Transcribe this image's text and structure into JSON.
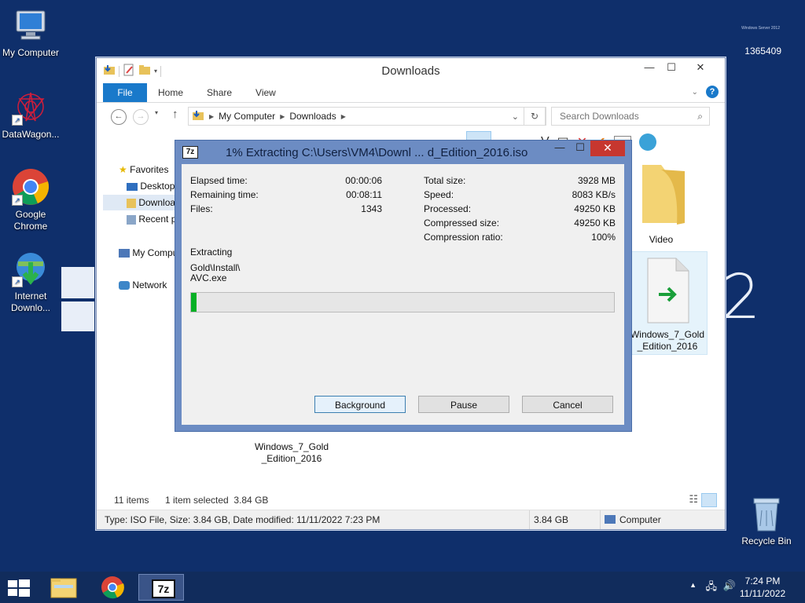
{
  "desktop": {
    "build_text": "1365409",
    "build_tiny": "Windows Server 2012",
    "bg_suffix": "2",
    "icons": [
      {
        "label": "My Computer",
        "icon": "computer-icon"
      },
      {
        "label": "DataWagon...",
        "icon": "datawagon-icon"
      },
      {
        "label": "Google Chrome",
        "icon": "chrome-icon"
      },
      {
        "label": "Internet Downlo...",
        "icon": "internet-download-manager-icon"
      },
      {
        "label": "Recycle Bin",
        "icon": "recycle-bin-icon"
      }
    ]
  },
  "explorer": {
    "title": "Downloads",
    "ribbon_tabs": [
      "File",
      "Home",
      "Share",
      "View"
    ],
    "address": {
      "seg1": "My Computer",
      "seg2": "Downloads"
    },
    "search_placeholder": "Search Downloads",
    "nav": {
      "favorites": "Favorites",
      "desktop": "Desktop",
      "downloads": "Downloads",
      "recent": "Recent places",
      "mycomputer": "My Computer",
      "network": "Network"
    },
    "files": {
      "video": "Video",
      "iso_right": "Windows_7_Gold\n_Edition_2016",
      "iso_bottom": "Windows_7_Gold\n_Edition_2016"
    },
    "status": {
      "items": "11 items",
      "selected": "1 item selected  3.84 GB"
    },
    "details": {
      "info": "Type: ISO File, Size: 3.84 GB, Date modified: 11/11/2022 7:23 PM",
      "size": "3.84 GB",
      "location": "Computer"
    }
  },
  "dialog": {
    "title": "1% Extracting C:\\Users\\VM4\\Downl ... d_Edition_2016.iso",
    "logo": "7z",
    "left": [
      {
        "label": "Elapsed time:",
        "value": "00:00:06"
      },
      {
        "label": "Remaining time:",
        "value": "00:08:11"
      },
      {
        "label": "Files:",
        "value": "1343"
      }
    ],
    "right": [
      {
        "label": "Total size:",
        "value": "3928 MB"
      },
      {
        "label": "Speed:",
        "value": "8083 KB/s"
      },
      {
        "label": "Processed:",
        "value": "49250 KB"
      },
      {
        "label": "Compressed size:",
        "value": "49250 KB"
      },
      {
        "label": "Compression ratio:",
        "value": "100%"
      }
    ],
    "operation": "Extracting",
    "path": "Gold\\Install\\",
    "file": "AVC.exe",
    "progress_percent": 1,
    "buttons": {
      "background": "Background",
      "pause": "Pause",
      "cancel": "Cancel"
    }
  },
  "taskbar": {
    "time": "7:24 PM",
    "date": "11/11/2022",
    "apps": [
      "file-explorer-icon",
      "chrome-icon",
      "7zip-icon"
    ],
    "zip_logo": "7z"
  },
  "colors": {
    "desktop": "#0f2f6b",
    "taskbar": "#112c5c",
    "accent": "#1979ca",
    "progress": "#06b025",
    "close": "#c7372f"
  }
}
